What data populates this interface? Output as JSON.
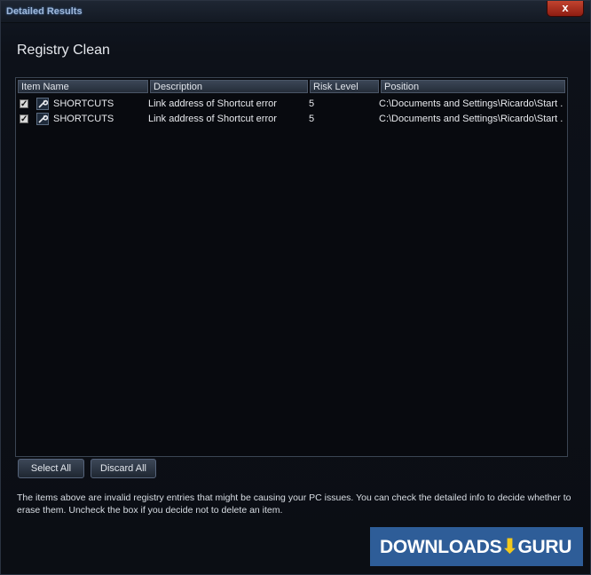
{
  "window": {
    "title": "Detailed Results",
    "close_label": "x"
  },
  "heading": "Registry Clean",
  "table": {
    "columns": [
      "Item Name",
      "Description",
      "Risk Level",
      "Position"
    ],
    "rows": [
      {
        "checked": true,
        "icon": "wrench-icon",
        "item_name": "SHORTCUTS",
        "description": "Link address of Shortcut error",
        "risk_level": "5",
        "position": "C:\\Documents and Settings\\Ricardo\\Start ..."
      },
      {
        "checked": true,
        "icon": "wrench-icon",
        "item_name": "SHORTCUTS",
        "description": "Link address of Shortcut error",
        "risk_level": "5",
        "position": "C:\\Documents and Settings\\Ricardo\\Start ..."
      }
    ]
  },
  "buttons": {
    "select_all": "Select All",
    "discard_all": "Discard All"
  },
  "info_text": "The items above are invalid registry entries that might be causing your PC issues. You can check the detailed info to decide whether to erase them. Uncheck the box if you decide not to delete an item.",
  "watermark": {
    "left": "DOWNLOADS",
    "right": "GURU"
  },
  "colors": {
    "accent": "#9fb7d8",
    "close_button": "#b43522",
    "watermark_bg": "#2e5d98"
  }
}
